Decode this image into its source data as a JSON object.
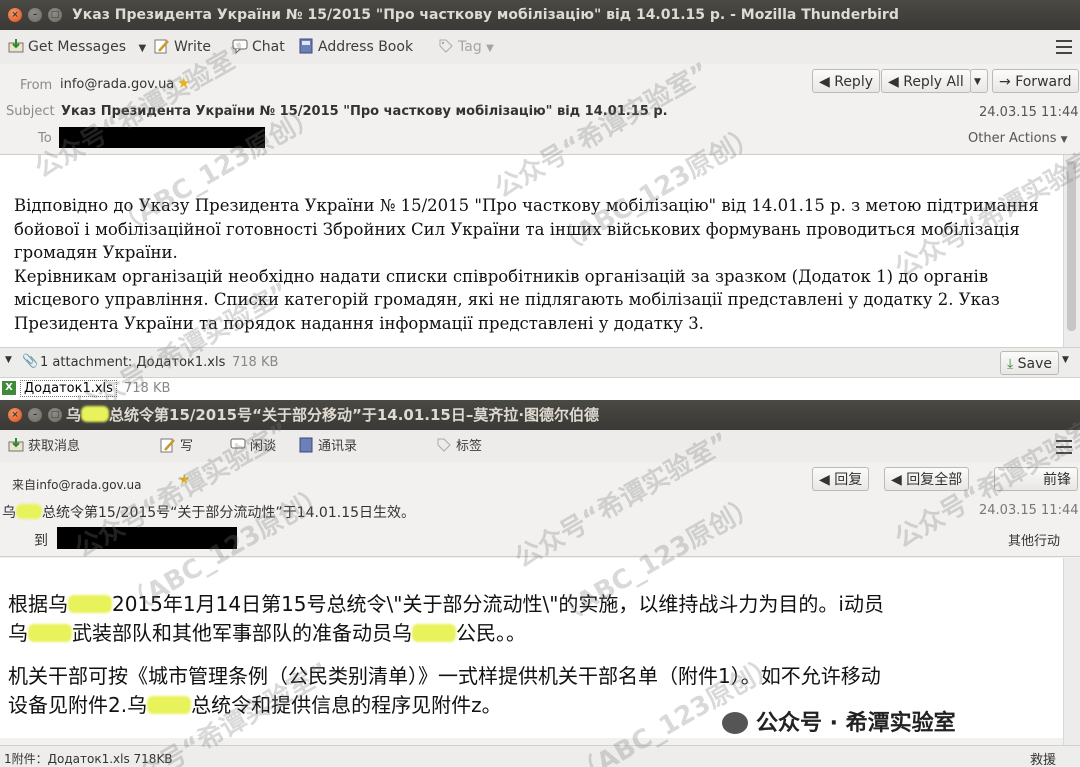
{
  "top": {
    "title": "Указ Президента України № 15/2015 \"Про часткову мобілізацію\" від 14.01.15 р. - Mozilla Thunderbird",
    "toolbar": {
      "get_messages": "Get Messages",
      "write": "Write",
      "chat": "Chat",
      "address_book": "Address Book",
      "tag": "Tag"
    },
    "header": {
      "from_label": "From",
      "from_value": "info@rada.gov.ua",
      "subject_label": "Subject",
      "subject_value": "Указ Президента України № 15/2015 \"Про часткову мобілізацію\" від 14.01.15 р.",
      "to_label": "To",
      "date": "24.03.15 11:44",
      "reply": "Reply",
      "reply_all": "Reply All",
      "forward": "Forward",
      "other_actions": "Other Actions"
    },
    "body": {
      "p1": "Відповідно до Указу Президента України № 15/2015 \"Про часткову мобілізацію\" від 14.01.15 р. з метою підтримання бойової і мобілізаційної готовності Збройних Сил України та інших військових формувань проводиться мобілізація громадян України.",
      "p2": "Керівникам організацій необхідно надати списки співробітників організацій за зразком (Додаток 1) до органів місцевого управління. Списки категорій громадян, які не підлягають мобілізації представлені у додатку 2. Указ Президента України та порядок надання інформації представлені у додатку 3."
    },
    "attachment": {
      "summary": "1 attachment: Додаток1.xls",
      "size": "718 KB",
      "save": "Save",
      "file_name": "Додаток1.xls",
      "file_size": "718 KB"
    }
  },
  "bottom": {
    "title_pre": "乌",
    "title_post": "总统令第15/2015号“关于部分移动”于14.01.15日–莫齐拉·图德尔伯德",
    "toolbar": {
      "get_messages": "获取消息",
      "write": "写",
      "chat": "闲谈",
      "address_book": "通讯录",
      "tag": "标签"
    },
    "header": {
      "from_value": "来自info@rada.gov.ua",
      "subject_pre": "乌",
      "subject_post": "总统令第15/2015号“关于部分流动性”于14.01.15日生效。",
      "to_label": "到",
      "date": "24.03.15 11:44",
      "reply": "回复",
      "reply_all": "回复全部",
      "forward": "前锋",
      "other_actions": "其他行动"
    },
    "body": {
      "l1a": "根据乌",
      "l1b": "2015年1月14日第15号总统令\\\"关于部分流动性\\\"的实施，以维持战斗力为目的。i动员",
      "l2a": "乌",
      "l2b": "武装部队和其他军事部队的准备动员乌",
      "l2c": "公民。。",
      "l3": "机关干部可按《城市管理条例（公民类别清单）》一式样提供机关干部名单（附件1）。如不允许移动",
      "l4a": "设备见附件2.乌",
      "l4b": "总统令和提供信息的程序见附件z。"
    },
    "attachment": {
      "summary": "1附件：Додаток1.xls 718KB",
      "save": "救援"
    }
  },
  "watermark": {
    "text_a": "公众号“希谭实验室”",
    "text_b": "（ABC_123原创）",
    "footer": "公众号 · 希潭实验室"
  }
}
